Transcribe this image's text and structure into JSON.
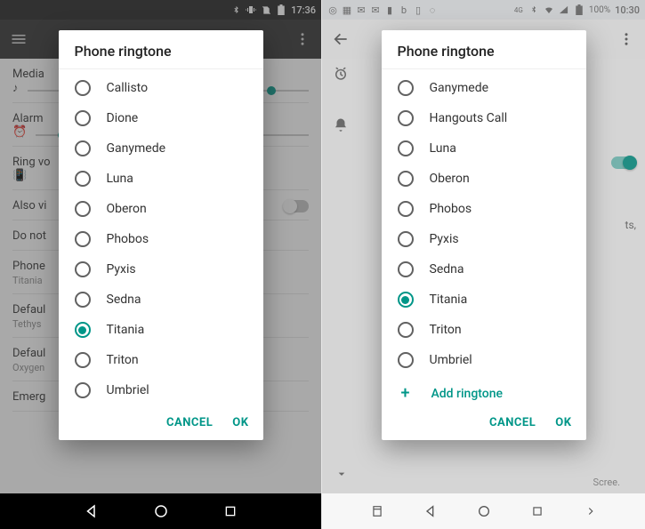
{
  "left": {
    "status": {
      "time": "17:36"
    },
    "dialog": {
      "title": "Phone ringtone",
      "options": [
        "Callisto",
        "Dione",
        "Ganymede",
        "Luna",
        "Oberon",
        "Phobos",
        "Pyxis",
        "Sedna",
        "Titania",
        "Triton",
        "Umbriel"
      ],
      "selected": "Titania",
      "cancel": "CANCEL",
      "ok": "OK"
    },
    "bg": {
      "media": "Media",
      "alarm": "Alarm",
      "ring": "Ring vo",
      "also": "Also vi",
      "dnd": "Do not",
      "phone": "Phone",
      "phone_sub": "Titania",
      "def1": "Defaul",
      "def1_sub": "Tethys",
      "def2": "Defaul",
      "def2_sub": "Oxygen",
      "emerg": "Emerg"
    }
  },
  "right": {
    "status": {
      "batt": "100%",
      "time": "10:30"
    },
    "dialog": {
      "title": "Phone ringtone",
      "options": [
        "Ganymede",
        "Hangouts Call",
        "Luna",
        "Oberon",
        "Phobos",
        "Pyxis",
        "Sedna",
        "Titania",
        "Triton",
        "Umbriel"
      ],
      "selected": "Titania",
      "add": "Add ringtone",
      "cancel": "CANCEL",
      "ok": "OK"
    },
    "bg": {
      "trail1": "ts,",
      "trail2": "Scree."
    }
  }
}
